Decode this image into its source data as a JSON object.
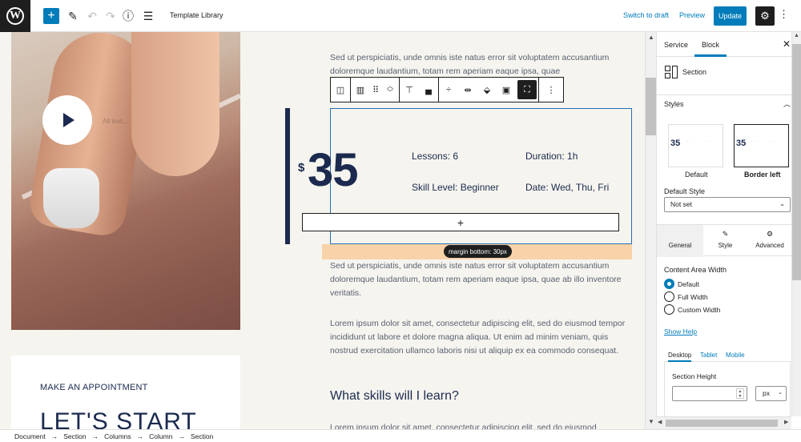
{
  "topbar": {
    "title": "Template Library",
    "switch_to_draft": "Switch to draft",
    "preview": "Preview",
    "update": "Update"
  },
  "canvas": {
    "photo_alt": "Alt text...",
    "appointment_kicker": "MAKE AN APPOINTMENT",
    "appointment_heading": "LET'S START",
    "para_top": "Sed ut perspiciatis, unde omnis iste natus error sit voluptatem accusantium doloremque laudantium, totam rem aperiam eaque ipsa, quae",
    "pricing": {
      "currency": "$",
      "amount": "35",
      "lessons": "Lessons: 6",
      "duration": "Duration: 1h",
      "skill": "Skill Level: Beginner",
      "date": "Date: Wed, Thu, Fri",
      "appender": "+"
    },
    "margin_label": "margin bottom: 30px",
    "para_1": "Sed ut perspiciatis, unde omnis iste natus error sit voluptatem accusantium doloremque laudantium, totam rem aperiam eaque ipsa, quae ab illo inventore veritatis.",
    "para_2": "Lorem ipsum dolor sit amet, consectetur adipiscing elit, sed do eiusmod tempor incididunt ut labore et dolore magna aliqua. Ut enim ad minim veniam, quis nostrud exercitation ullamco laboris nisi ut aliquip ex ea commodo consequat.",
    "heading": "What skills will I learn?",
    "para_3": "Lorem ipsum dolor sit amet, consectetur adipiscing elit, sed do eiusmod"
  },
  "sidebar": {
    "tab_service": "Service",
    "tab_block": "Block",
    "block_name": "Section",
    "styles_heading": "Styles",
    "style_default": "Default",
    "style_border_left": "Border left",
    "default_style_label": "Default Style",
    "default_style_value": "Not set",
    "sub_tabs": [
      {
        "icon": "",
        "label": "General"
      },
      {
        "icon": "✎",
        "label": "Style"
      },
      {
        "icon": "⚙",
        "label": "Advanced"
      }
    ],
    "content_area_width": "Content Area Width",
    "width_options": [
      "Default",
      "Full Width",
      "Custom Width"
    ],
    "show_help": "Show Help",
    "device_tabs": [
      "Desktop",
      "Tablet",
      "Mobile"
    ],
    "section_height_label": "Section Height",
    "unit": "px"
  },
  "footer": {
    "breadcrumbs": [
      "Document",
      "Section",
      "Columns",
      "Column",
      "Section"
    ]
  }
}
